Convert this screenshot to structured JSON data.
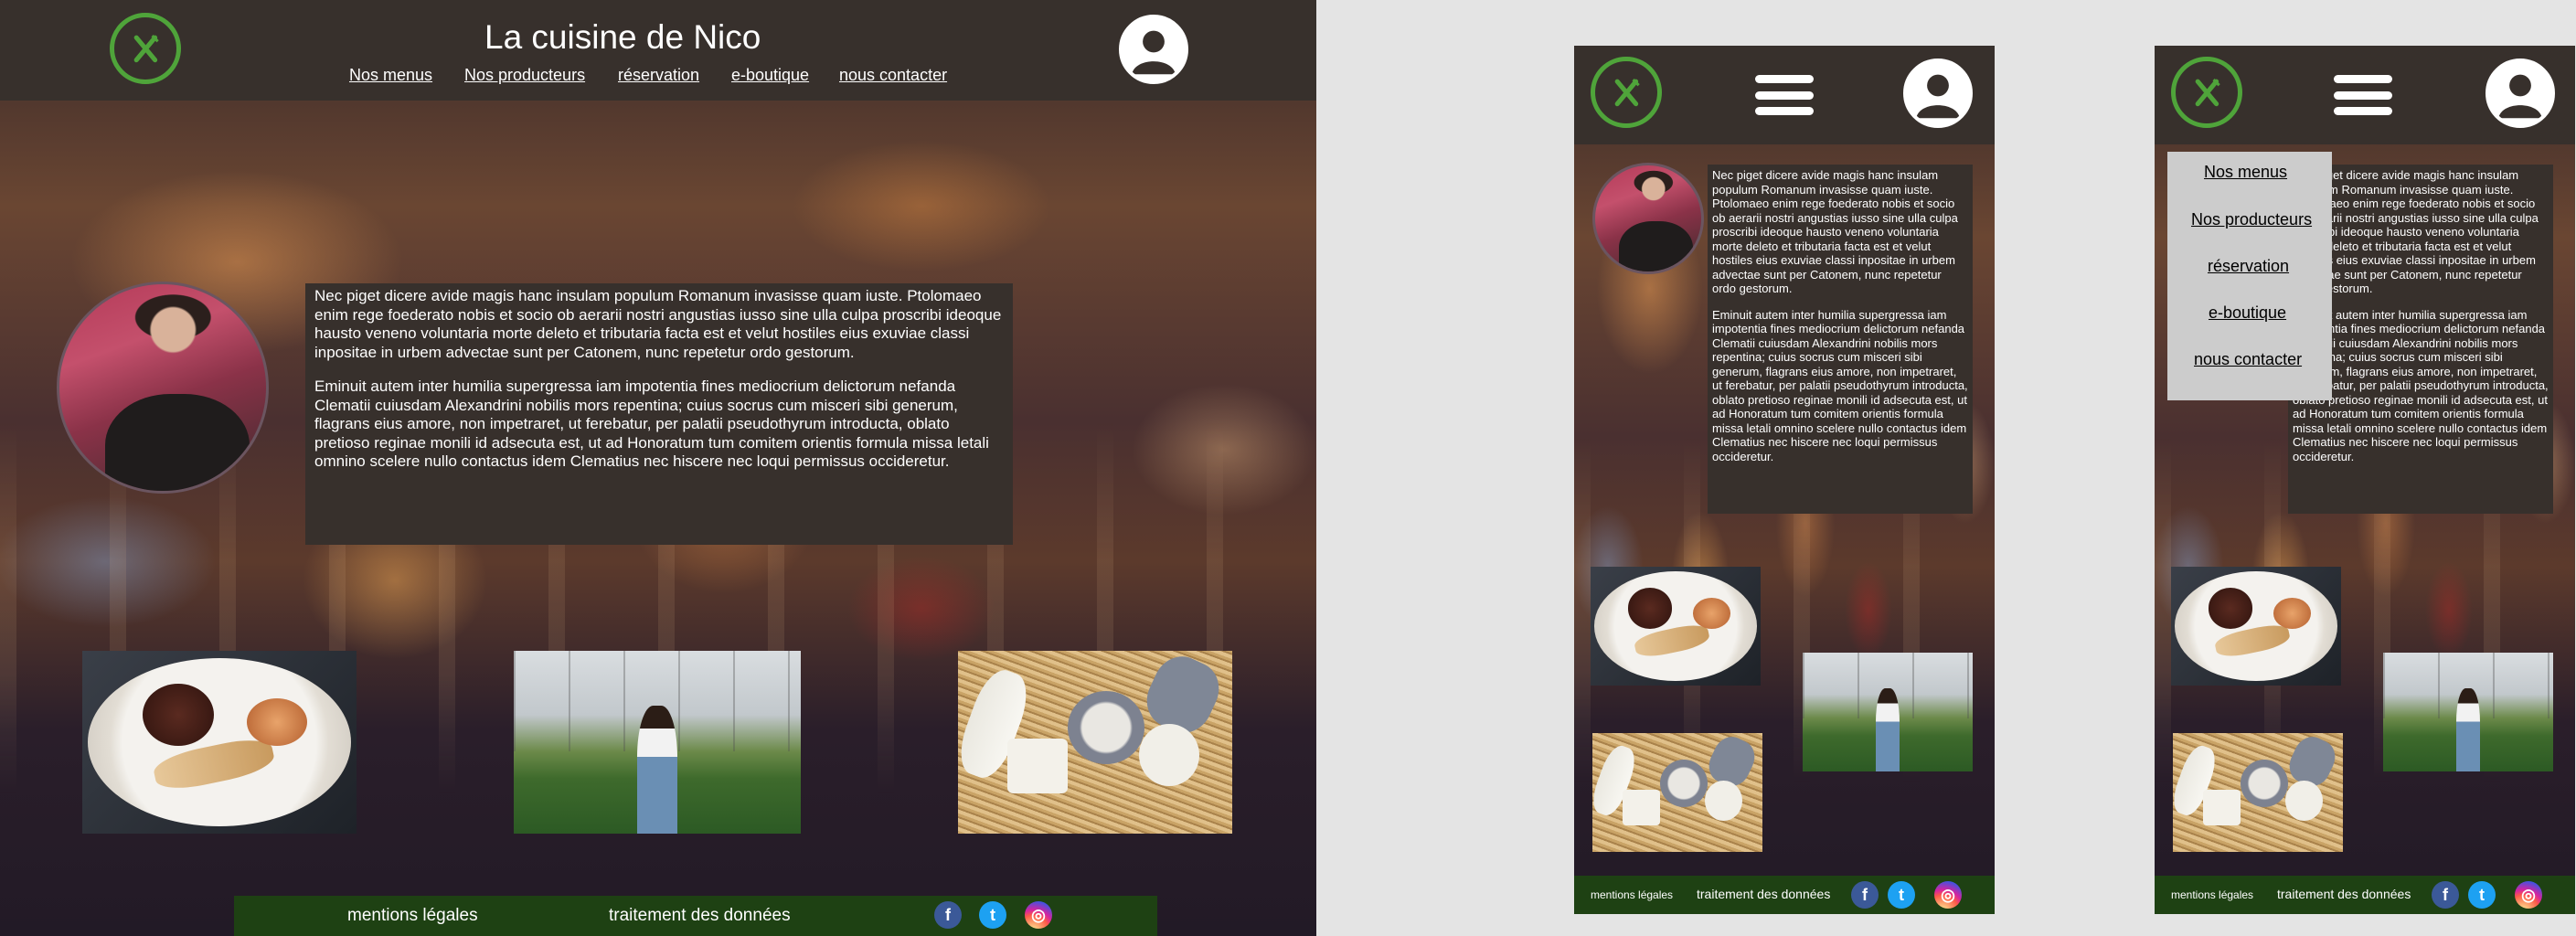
{
  "site": {
    "title": "La cuisine de Nico"
  },
  "nav": [
    {
      "label": "Nos menus"
    },
    {
      "label": "Nos producteurs"
    },
    {
      "label": "réservation"
    },
    {
      "label": "e-boutique"
    },
    {
      "label": "nous contacter"
    }
  ],
  "content": {
    "paragraph1": "Nec piget dicere avide magis hanc insulam populum Romanum invasisse quam iuste. Ptolomaeo enim rege foederato nobis et socio ob aerarii nostri angustias iusso sine ulla culpa proscribi ideoque hausto veneno voluntaria morte deleto et tributaria facta est et velut hostiles eius exuviae classi inpositae in urbem advectae sunt per Catonem, nunc repetetur ordo gestorum.",
    "paragraph2": "Eminuit autem inter humilia supergressa iam impotentia fines mediocrium delictorum nefanda Clematii cuiusdam Alexandrini nobilis mors repentina; cuius socrus cum misceri sibi generum, flagrans eius amore, non impetraret, ut ferebatur, per palatii pseudothyrum introducta, oblato pretioso reginae monili id adsecuta est, ut ad Honoratum tum comitem orientis formula missa letali omnino scelere nullo contactus idem Clematius nec hiscere nec loqui permissus occideretur."
  },
  "footer": {
    "legal": "mentions légales",
    "privacy": "traitement des données",
    "social": [
      {
        "icon": "facebook-icon",
        "glyph": "f"
      },
      {
        "icon": "twitter-icon",
        "glyph": "t"
      },
      {
        "icon": "instagram-icon",
        "glyph": "◎"
      }
    ]
  },
  "colors": {
    "header": "#37302c",
    "footer": "#1e4113",
    "logo_green": "#4fa43a",
    "dropdown": "#cccccc",
    "canvas": "#e4e4e4"
  },
  "icons": {
    "logo": "fork-knife-logo-icon",
    "account": "user-avatar-icon",
    "menu": "hamburger-menu-icon"
  }
}
